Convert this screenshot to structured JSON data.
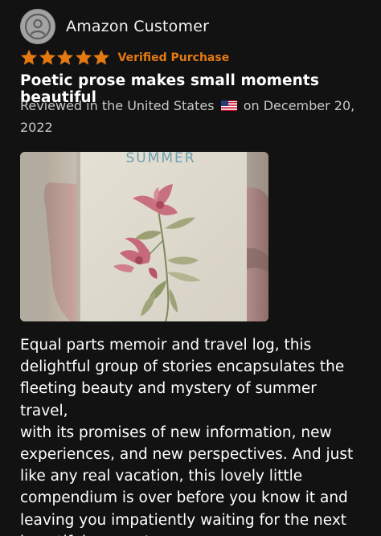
{
  "review": {
    "reviewer_name": "Amazon Customer",
    "avatar_icon": "default-user-avatar-icon",
    "rating": 5,
    "rating_max": 5,
    "star_color": "#e47911",
    "verified_label": "Verified Purchase",
    "title": "Poetic prose makes small moments beautiful",
    "meta_prefix": "Reviewed in the United States",
    "flag_icon": "us-flag-icon",
    "meta_suffix": "on December 20, 2022",
    "image": {
      "cover_text": "SUMMER",
      "description_icon": "book-cover-photo"
    },
    "body": "Equal parts memoir and travel log, this\ndelightful group of stories encapsulates the\nfleeting beauty and mystery of summer travel,\nwith its promises of new information, new\nexperiences, and new perspectives. And just\nlike any real vacation, this lovely little\ncompendium is over before you know it and\nleaving you impatiently waiting for the next\nbeautiful escape!"
  }
}
